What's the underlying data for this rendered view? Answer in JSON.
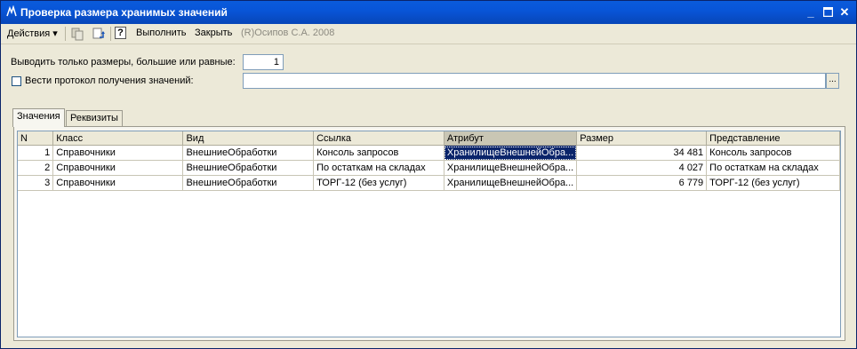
{
  "window": {
    "title": "Проверка размера хранимых значений",
    "title_icon": "form-icon",
    "buttons": [
      "minimize-icon",
      "maximize-icon",
      "close-icon"
    ]
  },
  "toolbar": {
    "actions_label": "Действия",
    "execute_label": "Выполнить",
    "close_label": "Закрыть",
    "copyright": "(R)Осипов С.А. 2008",
    "help_icon": "?"
  },
  "form": {
    "min_size_label": "Выводить только размеры, большие или равные:",
    "min_size_value": "1",
    "log_label": "Вести протокол получения значений:",
    "log_checked": false,
    "log_value": "",
    "browse_label": "..."
  },
  "tabs": [
    {
      "label": "Значения",
      "active": true
    },
    {
      "label": "Реквизиты",
      "active": false
    }
  ],
  "table": {
    "columns": [
      "N",
      "Класс",
      "Вид",
      "Ссылка",
      "Атрибут",
      "Размер",
      "Представление"
    ],
    "rows": [
      [
        "1",
        "Справочники",
        "ВнешниеОбработки",
        "Консоль запросов",
        "ХранилищеВнешнейОбра...",
        "34 481",
        "Консоль запросов"
      ],
      [
        "2",
        "Справочники",
        "ВнешниеОбработки",
        "По остаткам на складах",
        "ХранилищеВнешнейОбра...",
        "4 027",
        "По остаткам на складах"
      ],
      [
        "3",
        "Справочники",
        "ВнешниеОбработки",
        "ТОРГ-12 (без услуг)",
        "ХранилищеВнешнейОбра...",
        "6 779",
        "ТОРГ-12 (без услуг)"
      ]
    ]
  },
  "colors": {
    "title_bar": "#0855d8",
    "selection": "#0a246a",
    "background": "#ece9d8"
  }
}
